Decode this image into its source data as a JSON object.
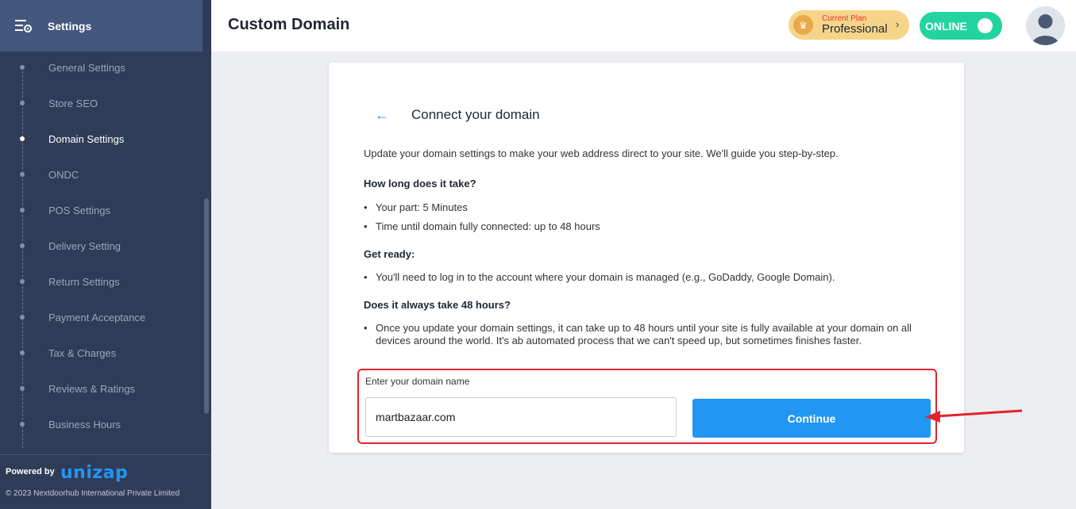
{
  "sidebar": {
    "title": "Settings",
    "items": [
      {
        "label": "General Settings"
      },
      {
        "label": "Store SEO"
      },
      {
        "label": "Domain Settings"
      },
      {
        "label": "ONDC"
      },
      {
        "label": "POS Settings"
      },
      {
        "label": "Delivery Setting"
      },
      {
        "label": "Return Settings"
      },
      {
        "label": "Payment Acceptance"
      },
      {
        "label": "Tax & Charges"
      },
      {
        "label": "Reviews & Ratings"
      },
      {
        "label": "Business Hours"
      }
    ],
    "active_item": "Domain Settings",
    "footer": {
      "powered_by": "Powered by",
      "brand": "unizap",
      "copyright": "© 2023 Nextdoorhub International Private Limited"
    }
  },
  "header": {
    "title": "Custom Domain",
    "plan": {
      "caption": "Current Plan",
      "name": "Professional"
    },
    "status": {
      "label": "ONLINE",
      "on": true
    }
  },
  "card": {
    "title": "Connect your domain",
    "intro": "Update your domain settings to make your web address direct to your site. We'll guide you step-by-step.",
    "sections": [
      {
        "heading": "How long does it take?",
        "bullets": [
          "Your part: 5 Minutes",
          "Time until domain fully connected: up to 48 hours"
        ]
      },
      {
        "heading": "Get ready:",
        "bullets": [
          "You'll need to log in to the account where your domain is managed (e.g., GoDaddy, Google Domain)."
        ]
      },
      {
        "heading": "Does it always take 48 hours?",
        "bullets": [
          "Once you update your domain settings, it can take up to 48 hours until your site is fully available at your domain on all devices around the world. It's ab automated process that we can't speed up, but sometimes finishes faster."
        ]
      }
    ],
    "domain_label": "Enter your domain name",
    "domain_value": "martbazaar.com",
    "continue_label": "Continue"
  },
  "colors": {
    "accent": "#2196f3",
    "sidebar": "#2f3c58",
    "online": "#23d3a0",
    "highlight": "#e3232b"
  }
}
